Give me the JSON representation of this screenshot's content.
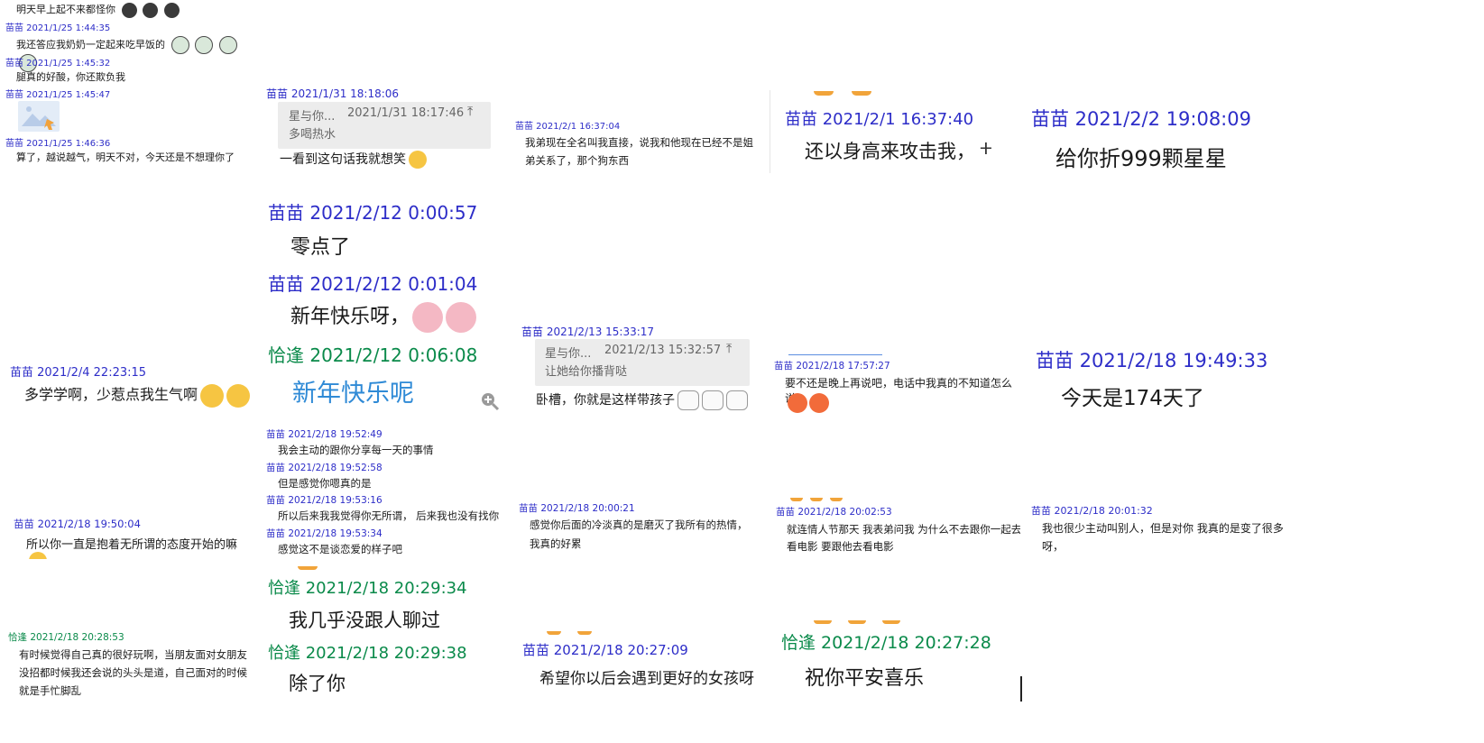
{
  "tiles": {
    "t1": {
      "l1": "明天早上起不来都怪你",
      "h1": "苗苗 2021/1/25 1:44:35",
      "m1": "我还答应我奶奶一定起来吃早饭的",
      "h2": "苗苗 2021/1/25 1:45:32",
      "m2": "腿真的好酸，你还欺负我",
      "h3": "苗苗 2021/1/25 1:45:47",
      "h4": "苗苗 2021/1/25 1:46:36",
      "m4": "算了，越说越气，明天不对，今天还是不想理你了"
    },
    "t2": {
      "h": "苗苗 2021/1/31 18:18:06",
      "q_name": "星与你...",
      "q_time": "2021/1/31 18:17:46",
      "q_text": "多喝热水",
      "m": "一看到这句话我就想笑"
    },
    "t3": {
      "h": "苗苗 2021/2/1 16:37:04",
      "m": "我弟现在全名叫我直接，说我和他现在已经不是姐弟关系了，那个狗东西"
    },
    "t4": {
      "h": "苗苗 2021/2/1 16:37:40",
      "m": "还以身高来攻击我，"
    },
    "t5": {
      "h": "苗苗 2021/2/2 19:08:09",
      "m": "给你折999颗星星"
    },
    "t6": {
      "h": "苗苗 2021/2/4 22:23:15",
      "m": "多学学啊，少惹点我生气啊"
    },
    "t7": {
      "h1": "苗苗 2021/2/12 0:00:57",
      "m1": "零点了",
      "h2": "苗苗 2021/2/12 0:01:04",
      "m2": "新年快乐呀，",
      "h3": "恰逢 2021/2/12 0:06:08",
      "m3": "新年快乐呢"
    },
    "t8": {
      "h": "苗苗 2021/2/13 15:33:17",
      "q_name": "星与你...",
      "q_time": "2021/2/13 15:32:57",
      "q_text": "让她给你播背哒",
      "m": "卧槽，你就是这样带孩子"
    },
    "t9": {
      "h": "苗苗 2021/2/18 17:57:27",
      "m": "要不还是晚上再说吧，电话中我真的不知道怎么说"
    },
    "t10": {
      "h": "苗苗 2021/2/18 19:49:33",
      "m": "今天是174天了"
    },
    "t11": {
      "h": "苗苗 2021/2/18 19:50:04",
      "m": "所以你一直是抱着无所谓的态度开始的嘛"
    },
    "t12": {
      "h1": "苗苗 2021/2/18 19:52:49",
      "m1": "我会主动的跟你分享每一天的事情",
      "h2": "苗苗 2021/2/18 19:52:58",
      "m2": "但是感觉你嗯真的是",
      "h3": "苗苗 2021/2/18 19:53:16",
      "m3": "所以后来我我觉得你无所谓， 后来我也没有找你",
      "h4": "苗苗 2021/2/18 19:53:34",
      "m4": "感觉这不是谈恋爱的样子吧"
    },
    "t13": {
      "h": "苗苗 2021/2/18 20:00:21",
      "m": "感觉你后面的冷淡真的是磨灭了我所有的热情，我真的好累"
    },
    "t14": {
      "h": "苗苗 2021/2/18 20:02:53",
      "m": "就连情人节那天 我表弟问我 为什么不去跟你一起去看电影 要跟他去看电影"
    },
    "t15": {
      "h": "苗苗 2021/2/18 20:01:32",
      "m": "我也很少主动叫别人，但是对你 我真的是变了很多呀，"
    },
    "t16": {
      "h": "恰逢 2021/2/18 20:28:53",
      "m": "有时候觉得自己真的很好玩啊，当朋友面对女朋友没招都时候我还会说的头头是道，自己面对的时候就是手忙脚乱"
    },
    "t17": {
      "h1": "恰逢 2021/2/18 20:29:34",
      "m1": "我几乎没跟人聊过",
      "h2": "恰逢 2021/2/18 20:29:38",
      "m2": "除了你"
    },
    "t18": {
      "h": "苗苗 2021/2/18 20:27:09",
      "m": "希望你以后会遇到更好的女孩呀"
    },
    "t19": {
      "h": "恰逢 2021/2/18 20:27:28",
      "m": "祝你平安喜乐"
    }
  }
}
